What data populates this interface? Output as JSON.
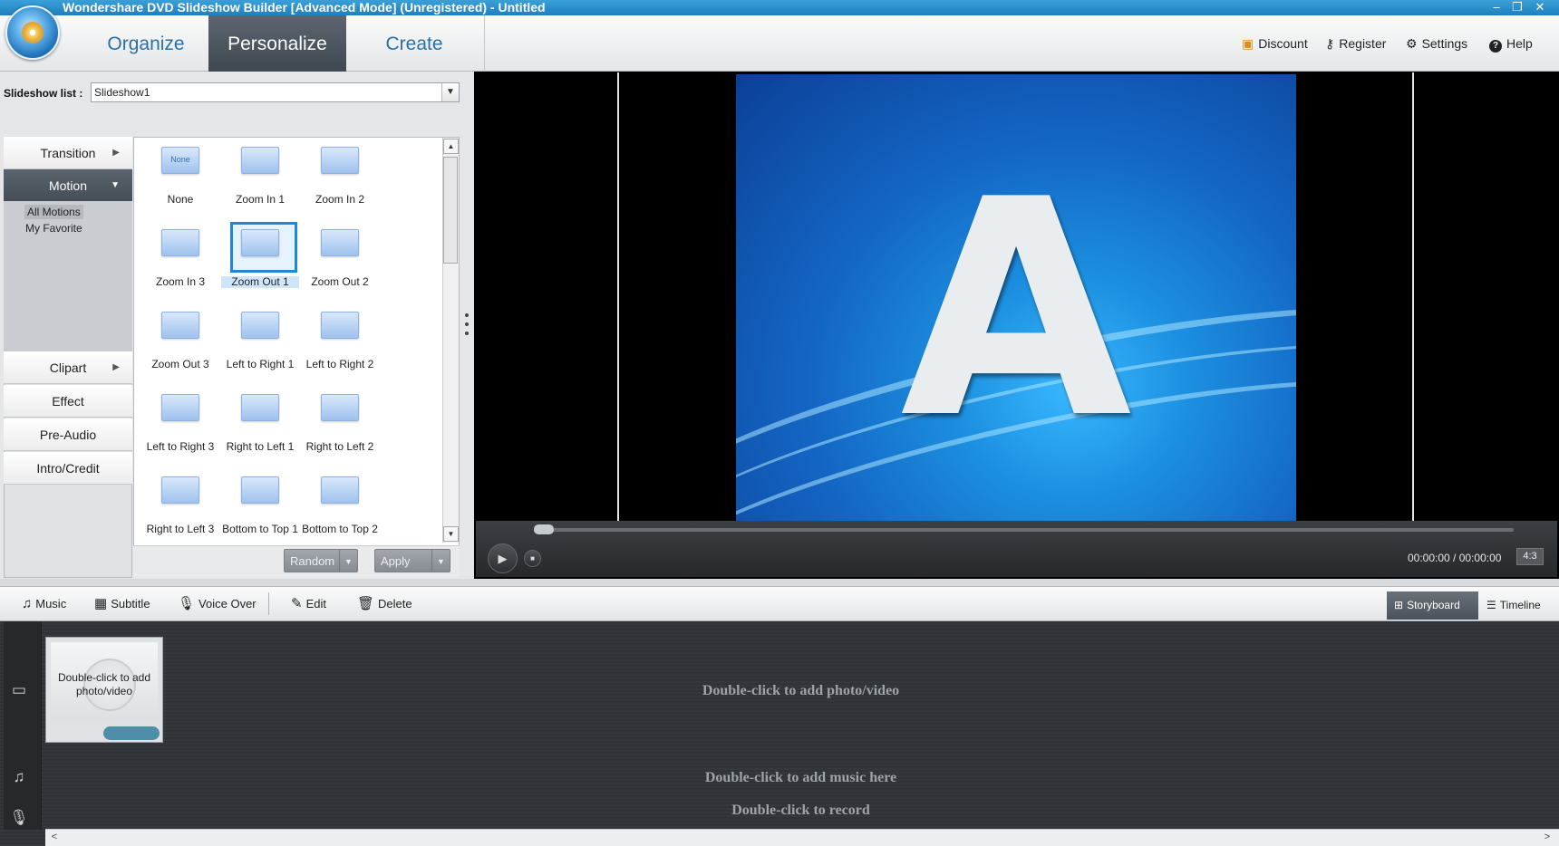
{
  "window": {
    "title": "Wondershare DVD Slideshow Builder [Advanced Mode] (Unregistered) - Untitled",
    "minimize": "–",
    "restore": "❐",
    "close": "✕"
  },
  "menu": {
    "tabs": [
      {
        "label": "Organize",
        "active": false
      },
      {
        "label": "Personalize",
        "active": true
      },
      {
        "label": "Create",
        "active": false
      }
    ],
    "links": [
      {
        "label": "Discount",
        "icon": "gift-icon"
      },
      {
        "label": "Register",
        "icon": "key-icon"
      },
      {
        "label": "Settings",
        "icon": "gear-icon"
      },
      {
        "label": "Help",
        "icon": "help-icon"
      }
    ]
  },
  "slideshow": {
    "label": "Slideshow list :",
    "value": "Slideshow1"
  },
  "categories": {
    "transition": "Transition",
    "motion": "Motion",
    "motion_sub": [
      "All Motions",
      "My Favorite"
    ],
    "clipart": "Clipart",
    "effect": "Effect",
    "pre_audio": "Pre-Audio",
    "intro_credit": "Intro/Credit"
  },
  "motions": [
    {
      "label": "None",
      "thumb_text": "None"
    },
    {
      "label": "Zoom In 1"
    },
    {
      "label": "Zoom In 2"
    },
    {
      "label": "Zoom In 3"
    },
    {
      "label": "Zoom Out 1",
      "selected": true
    },
    {
      "label": "Zoom Out 2"
    },
    {
      "label": "Zoom Out 3"
    },
    {
      "label": "Left to Right 1"
    },
    {
      "label": "Left to Right 2"
    },
    {
      "label": "Left to Right 3"
    },
    {
      "label": "Right to Left 1"
    },
    {
      "label": "Right to Left 2"
    },
    {
      "label": "Right to Left 3"
    },
    {
      "label": "Bottom to Top 1"
    },
    {
      "label": "Bottom to Top 2"
    }
  ],
  "motion_buttons": {
    "random": "Random",
    "apply": "Apply"
  },
  "preview": {
    "letter": "A",
    "time": "00:00:00 / 00:00:00",
    "ratio": "4:3",
    "progress": 0
  },
  "toolbar": {
    "music": "Music",
    "subtitle": "Subtitle",
    "voice_over": "Voice Over",
    "edit": "Edit",
    "delete": "Delete",
    "storyboard": "Storyboard",
    "timeline": "Timeline"
  },
  "storyboard": {
    "clip_hint": "Double-click to add photo/video",
    "photo_hint": "Double-click to add photo/video",
    "music_hint": "Double-click to add music here",
    "record_hint": "Double-click to record"
  }
}
